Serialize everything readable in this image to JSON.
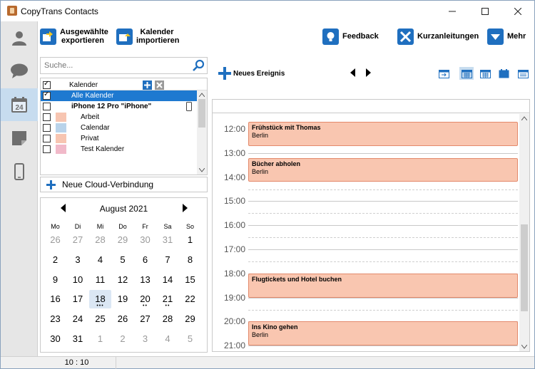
{
  "app": {
    "title": "CopyTrans Contacts",
    "colors": {
      "accent": "#1f6fbf",
      "active": "#c7dcef",
      "event_fill": "#f9c6b0",
      "event_border": "#e3896b"
    }
  },
  "toolbar": {
    "export_label": "Ausgewählte exportieren",
    "import_label": "Kalender importieren",
    "feedback_label": "Feedback",
    "guides_label": "Kurzanleitungen",
    "more_label": "Mehr"
  },
  "search": {
    "placeholder": "Suche..."
  },
  "calendars": {
    "header": "Kalender",
    "items": [
      {
        "label": "Alle Kalender",
        "checked": true,
        "selected": true,
        "swatch": ""
      },
      {
        "label": "iPhone 12 Pro \"iPhone\"",
        "checked": false,
        "device": true,
        "swatch": ""
      },
      {
        "label": "Arbeit",
        "checked": false,
        "swatch": "#f7c5b1"
      },
      {
        "label": "Calendar",
        "checked": false,
        "swatch": "#b9d3ea"
      },
      {
        "label": "Privat",
        "checked": false,
        "swatch": "#f7c5b1"
      },
      {
        "label": "Test Kalender",
        "checked": false,
        "swatch": "#f1b9c9"
      }
    ]
  },
  "cloud": {
    "label": "Neue Cloud-Verbindung"
  },
  "minical": {
    "month": "August 2021",
    "weekdays": [
      "Mo",
      "Di",
      "Mi",
      "Do",
      "Fr",
      "Sa",
      "So"
    ],
    "weeks": [
      [
        "26",
        "27",
        "28",
        "29",
        "30",
        "31",
        "1"
      ],
      [
        "2",
        "3",
        "4",
        "5",
        "6",
        "7",
        "8"
      ],
      [
        "9",
        "10",
        "11",
        "12",
        "13",
        "14",
        "15"
      ],
      [
        "16",
        "17",
        "18",
        "19",
        "20",
        "21",
        "22"
      ],
      [
        "23",
        "24",
        "25",
        "26",
        "27",
        "28",
        "29"
      ],
      [
        "30",
        "31",
        "1",
        "2",
        "3",
        "4",
        "5"
      ]
    ]
  },
  "events_toolbar": {
    "new_event_label": "Neues Ereignis"
  },
  "day_view": {
    "hours": [
      "12:00",
      "13:00",
      "14:00",
      "15:00",
      "16:00",
      "17:00",
      "18:00",
      "19:00",
      "20:00",
      "21:00"
    ],
    "events": [
      {
        "title": "Frühstück mit Thomas",
        "location": "Berlin"
      },
      {
        "title": "Bücher abholen",
        "location": "Berlin"
      },
      {
        "title": "Flugtickets und Hotel buchen",
        "location": ""
      },
      {
        "title": "Ins Kino gehen",
        "location": "Berlin"
      }
    ]
  },
  "status": {
    "time": "10 : 10"
  }
}
